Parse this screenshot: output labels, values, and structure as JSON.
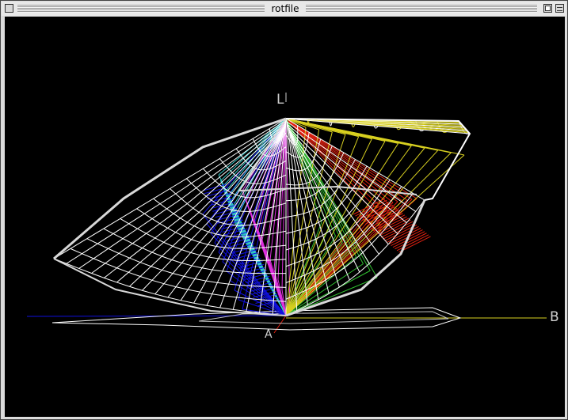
{
  "window": {
    "title": "rotfile"
  },
  "viewport": {
    "background": "#000000",
    "axes": {
      "l_label": "L",
      "b_label": "B",
      "a_label": "A"
    },
    "colors": {
      "wire": "#ffffff",
      "yellow": "#d8d020",
      "blue": "#1010e0",
      "cyan": "#30c8c8",
      "magenta": "#e030e0",
      "red": "#e02010",
      "green": "#30c030"
    }
  }
}
